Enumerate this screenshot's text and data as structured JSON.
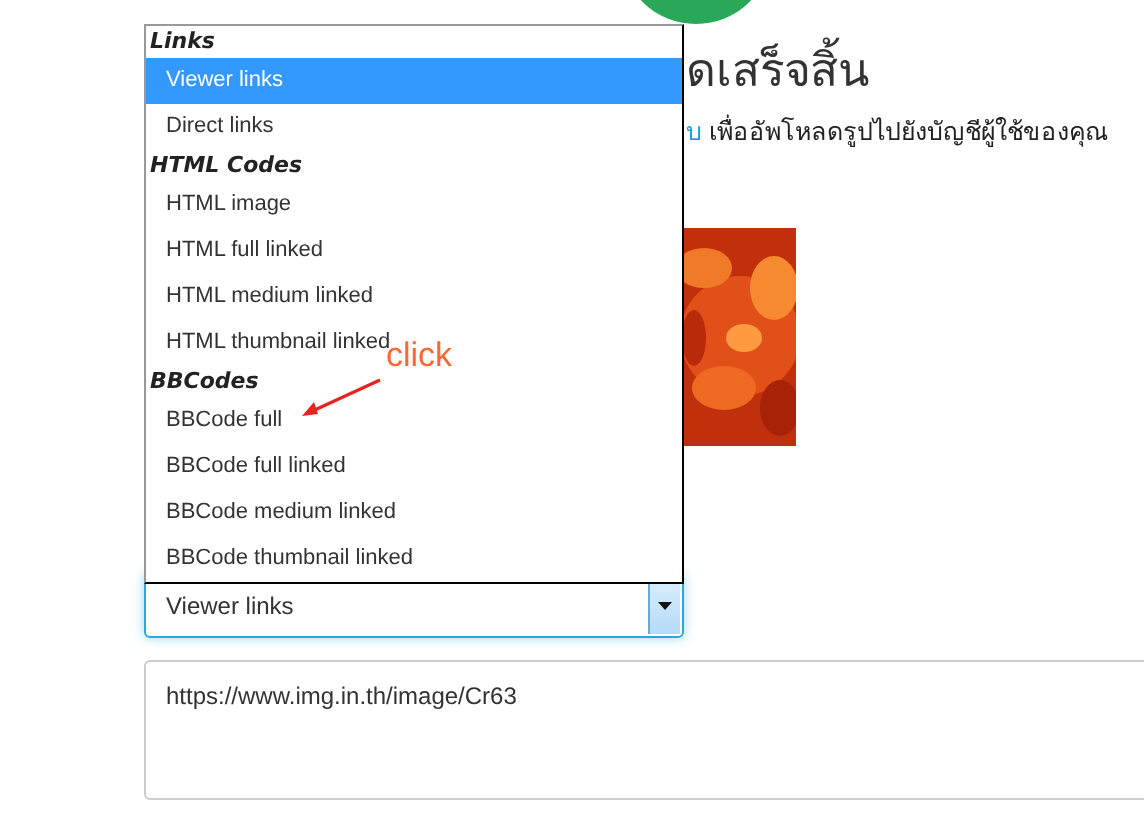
{
  "heading": "ดเสร็จสิ้น",
  "notice": {
    "link": "บ",
    "text": "เพื่ออัพโหลดรูปไปยังบัญชีผู้ใช้ของคุณ"
  },
  "dropdown": {
    "groups": [
      {
        "label": "Links",
        "options": [
          {
            "label": "Viewer links",
            "selected": true
          },
          {
            "label": "Direct links",
            "selected": false
          }
        ]
      },
      {
        "label": "HTML Codes",
        "options": [
          {
            "label": "HTML image",
            "selected": false
          },
          {
            "label": "HTML full linked",
            "selected": false
          },
          {
            "label": "HTML medium linked",
            "selected": false
          },
          {
            "label": "HTML thumbnail linked",
            "selected": false
          }
        ]
      },
      {
        "label": "BBCodes",
        "options": [
          {
            "label": "BBCode full",
            "selected": false
          },
          {
            "label": "BBCode full linked",
            "selected": false
          },
          {
            "label": "BBCode medium linked",
            "selected": false
          },
          {
            "label": "BBCode thumbnail linked",
            "selected": false
          }
        ]
      }
    ]
  },
  "select": {
    "value": "Viewer links"
  },
  "output": {
    "value": "https://www.img.in.th/image/Cr63"
  },
  "annotation": {
    "text": "click"
  }
}
